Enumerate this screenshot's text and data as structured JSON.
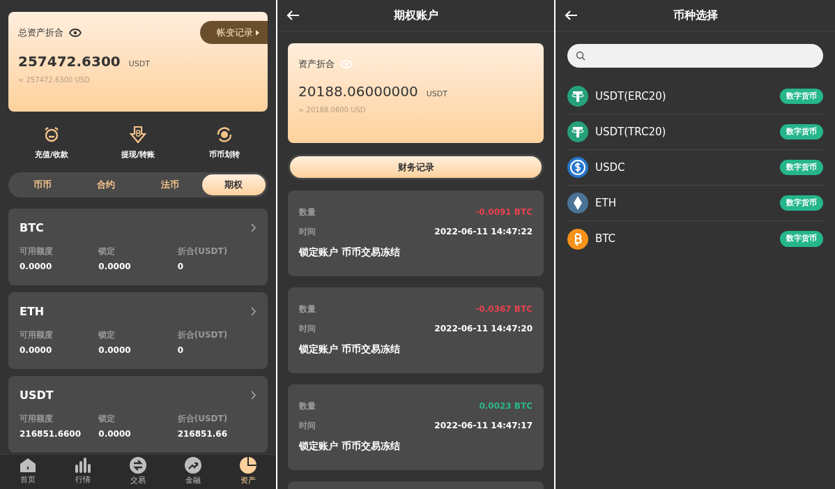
{
  "assets": {
    "total_label": "总资产折合",
    "history_button": "帐变记录",
    "total_value": "257472.6300",
    "total_unit": "USDT",
    "total_usd": "≈ 257472.6300 USD",
    "actions": [
      {
        "kind": "deposit",
        "label": "充值/收款"
      },
      {
        "kind": "withdraw",
        "label": "提现/转账"
      },
      {
        "kind": "transfer",
        "label": "币币划转"
      }
    ],
    "tabs": [
      {
        "label": "币币",
        "selected": false
      },
      {
        "label": "合约",
        "selected": false
      },
      {
        "label": "法币",
        "selected": false
      },
      {
        "label": "期权",
        "selected": true
      }
    ],
    "coins": [
      {
        "name": "BTC",
        "available_label": "可用额度",
        "available": "0.0000",
        "locked_label": "锁定",
        "locked": "0.0000",
        "value_label": "折合(USDT)",
        "value": "0"
      },
      {
        "name": "ETH",
        "available_label": "可用额度",
        "available": "0.0000",
        "locked_label": "锁定",
        "locked": "0.0000",
        "value_label": "折合(USDT)",
        "value": "0"
      },
      {
        "name": "USDT",
        "available_label": "可用额度",
        "available": "216851.6600",
        "locked_label": "锁定",
        "locked": "0.0000",
        "value_label": "折合(USDT)",
        "value": "216851.66"
      }
    ],
    "nav": [
      {
        "kind": "home",
        "label": "首页",
        "selected": false
      },
      {
        "kind": "market",
        "label": "行情",
        "selected": false
      },
      {
        "kind": "trade",
        "label": "交易",
        "selected": false
      },
      {
        "kind": "finance",
        "label": "金融",
        "selected": false
      },
      {
        "kind": "assets",
        "label": "资产",
        "selected": true
      }
    ]
  },
  "options_account": {
    "title": "期权账户",
    "balance_label": "资产折合",
    "balance": "20188.06000000",
    "balance_unit": "USDT",
    "balance_usd": "≈ 20188.0600 USD",
    "records_button": "财务记录",
    "records": [
      {
        "amount_label": "数量",
        "amount": "-0.0091 BTC",
        "color": "#e8414f",
        "time_label": "时间",
        "time": "2022-06-11 14:47:22",
        "description": "锁定账户 币币交易冻结"
      },
      {
        "amount_label": "数量",
        "amount": "-0.0367 BTC",
        "color": "#e8414f",
        "time_label": "时间",
        "time": "2022-06-11 14:47:20",
        "description": "锁定账户 币币交易冻结"
      },
      {
        "amount_label": "数量",
        "amount": "0.0023 BTC",
        "color": "#2bb88a",
        "time_label": "时间",
        "time": "2022-06-11 14:47:17",
        "description": "锁定账户 币币交易冻结"
      }
    ]
  },
  "currency_select": {
    "title": "币种选择",
    "currencies": [
      {
        "kind": "tether",
        "name": "USDT(ERC20)",
        "tag": "数字货币"
      },
      {
        "kind": "tether",
        "name": "USDT(TRC20)",
        "tag": "数字货币"
      },
      {
        "kind": "usdc",
        "name": "USDC",
        "tag": "数字货币"
      },
      {
        "kind": "eth",
        "name": "ETH",
        "tag": "数字货币"
      },
      {
        "kind": "btc",
        "name": "BTC",
        "tag": "数字货币"
      }
    ]
  }
}
